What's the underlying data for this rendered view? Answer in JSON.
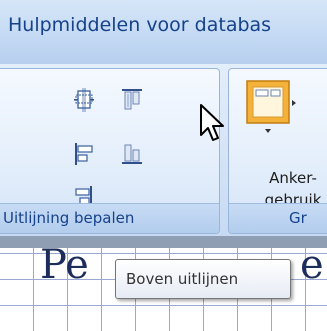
{
  "context_tab": {
    "title": "Hulpmiddelen voor databas"
  },
  "groups": {
    "align": {
      "label": "Uitlijning bepalen",
      "buttons": [
        {
          "name": "align-middle-icon",
          "tooltip": ""
        },
        {
          "name": "align-top-icon",
          "tooltip": "Boven uitlijnen"
        },
        {
          "name": "align-left-icon",
          "tooltip": ""
        },
        {
          "name": "align-bottom-icon",
          "tooltip": ""
        },
        {
          "name": "align-right-icon",
          "tooltip": ""
        }
      ]
    },
    "anchor": {
      "label": "Gr",
      "button_line1": "Anker-",
      "button_line2": "gebruik"
    }
  },
  "document": {
    "text_left": "Pe",
    "text_right": "e"
  },
  "tooltip": {
    "text": "Boven uitlijnen"
  },
  "colors": {
    "title_text": "#15428b",
    "group_border": "#99b6da",
    "tooltip_border": "#767676"
  }
}
